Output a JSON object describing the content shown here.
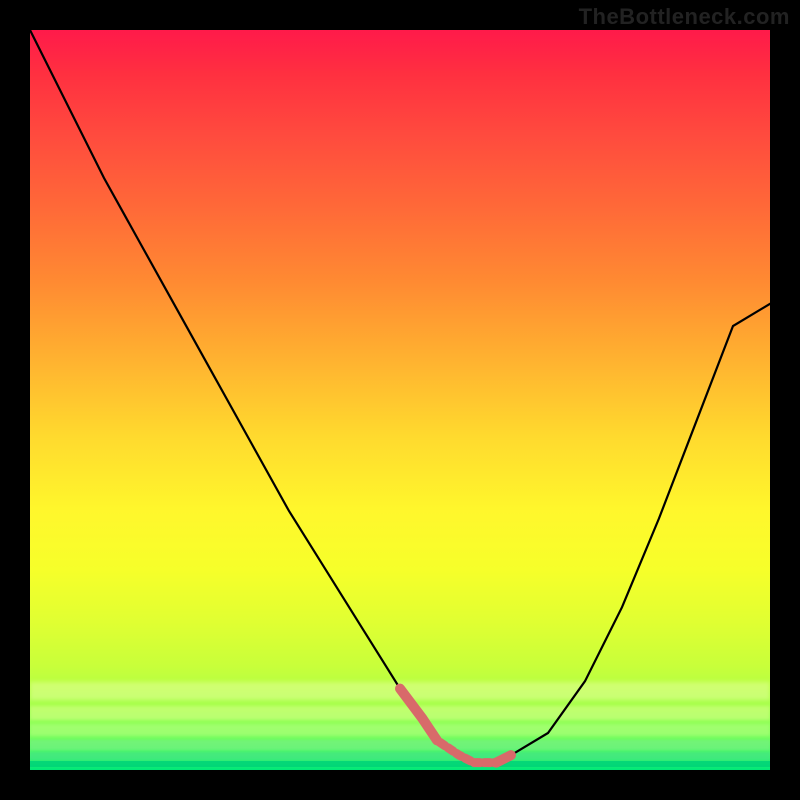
{
  "watermark": "TheBottleneck.com",
  "chart_data": {
    "type": "line",
    "title": "",
    "xlabel": "",
    "ylabel": "",
    "xlim": [
      0,
      100
    ],
    "ylim": [
      0,
      100
    ],
    "x": [
      0,
      5,
      10,
      15,
      20,
      25,
      30,
      35,
      40,
      45,
      50,
      53,
      55,
      58,
      60,
      63,
      65,
      70,
      75,
      80,
      85,
      90,
      95,
      100
    ],
    "values": [
      100,
      90,
      80,
      71,
      62,
      53,
      44,
      35,
      27,
      19,
      11,
      7,
      4,
      2,
      1,
      1,
      2,
      5,
      12,
      22,
      34,
      47,
      60,
      63
    ],
    "flat_region_x": [
      53,
      65
    ],
    "gradient_stops": [
      {
        "pos": 0.0,
        "color": "#ff1a4a"
      },
      {
        "pos": 0.5,
        "color": "#ffda2e"
      },
      {
        "pos": 0.8,
        "color": "#e0ff32"
      },
      {
        "pos": 1.0,
        "color": "#00e878"
      }
    ],
    "background": "#000000",
    "annotations": []
  }
}
